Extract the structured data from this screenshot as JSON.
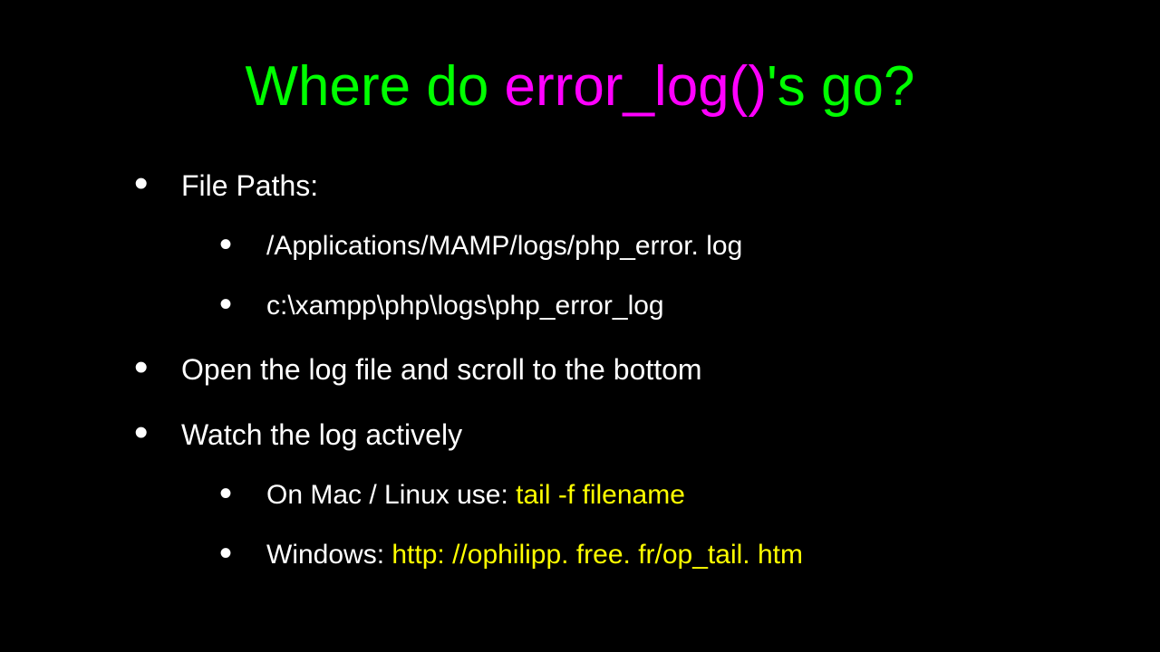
{
  "title": {
    "part1": "Where do ",
    "part2": "error_log()",
    "part3": "'s go?"
  },
  "bullets": {
    "file_paths_label": "File Paths:",
    "path_mac": "/Applications/MAMP/logs/php_error. log",
    "path_win": "c:\\xampp\\php\\logs\\php_error_log",
    "open_log": "Open the log file and scroll to the bottom",
    "watch_log": "Watch the log actively",
    "mac_linux_label": "On Mac / Linux use:  ",
    "mac_linux_cmd": "tail -f filename",
    "windows_label": "Windows:  ",
    "windows_link": "http: //ophilipp. free. fr/op_tail. htm"
  }
}
